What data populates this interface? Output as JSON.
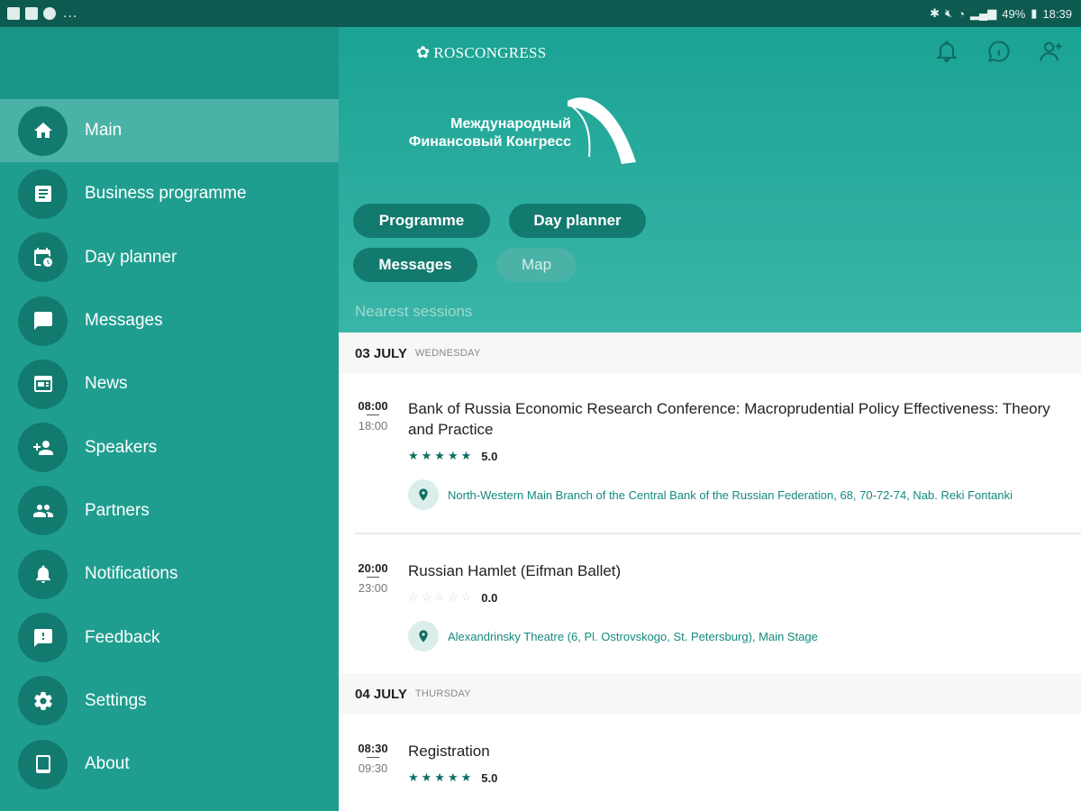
{
  "status_bar": {
    "dots": "...",
    "battery": "49%",
    "time": "18:39"
  },
  "sidebar": {
    "items": [
      {
        "label": "Main",
        "icon": "home-icon"
      },
      {
        "label": "Business programme",
        "icon": "document-icon"
      },
      {
        "label": "Day planner",
        "icon": "calendar-clock-icon"
      },
      {
        "label": "Messages",
        "icon": "chat-icon"
      },
      {
        "label": "News",
        "icon": "newspaper-icon"
      },
      {
        "label": "Speakers",
        "icon": "person-add-icon"
      },
      {
        "label": "Partners",
        "icon": "people-icon"
      },
      {
        "label": "Notifications",
        "icon": "bell-icon"
      },
      {
        "label": "Feedback",
        "icon": "feedback-icon"
      },
      {
        "label": "Settings",
        "icon": "gear-icon"
      },
      {
        "label": "About",
        "icon": "tablet-icon"
      }
    ]
  },
  "header": {
    "brand": "ROSCONGRESS",
    "congress_line1": "Международный",
    "congress_line2": "Финансовый Конгресс",
    "buttons": {
      "programme": "Programme",
      "day_planner": "Day planner",
      "messages": "Messages",
      "map": "Map"
    },
    "nearest_sessions": "Nearest sessions"
  },
  "days": [
    {
      "date": "03 JULY",
      "weekday": "WEDNESDAY",
      "sessions": [
        {
          "start": "08:00",
          "end": "18:00",
          "title": "Bank of Russia Economic Research Conference: Macroprudential Policy Effectiveness: Theory and Practice",
          "stars": "★★★★★",
          "rating": "5.0",
          "location": "North-Western Main Branch of the Central Bank of the Russian Federation, 68, 70-72-74, Nab. Reki Fontanki"
        },
        {
          "start": "20:00",
          "end": "23:00",
          "title": "Russian Hamlet (Eifman Ballet)",
          "stars": "☆☆☆☆☆",
          "rating": "0.0",
          "location": "Alexandrinsky Theatre (6, Pl. Ostrovskogo, St. Petersburg), Main Stage"
        }
      ]
    },
    {
      "date": "04 JULY",
      "weekday": "THURSDAY",
      "sessions": [
        {
          "start": "08:30",
          "end": "09:30",
          "title": "Registration",
          "stars": "★★★★★",
          "rating": "5.0"
        }
      ]
    }
  ],
  "colors": {
    "sidebar": "#1f9e90",
    "active_item": "#4ab2a6",
    "icon_circle": "#137a6f",
    "accent": "#0f6d63",
    "status_bar": "#0d5a50"
  }
}
